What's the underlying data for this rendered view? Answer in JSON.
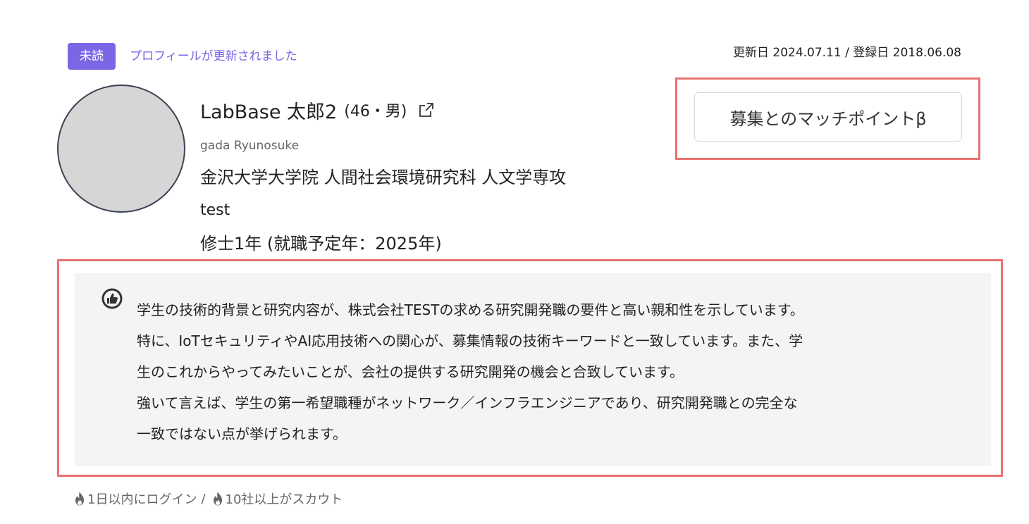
{
  "header": {
    "unread_badge": "未読",
    "update_link": "プロフィールが更新されました",
    "dates": "更新日 2024.07.11 / 登録日 2018.06.08"
  },
  "profile": {
    "name": "LabBase 太郎2",
    "age_gender": "(46・男)",
    "romaji": "gada Ryunosuke",
    "school": "金沢大学大学院 人間社会環境研究科 人文学専攻",
    "lab": "test",
    "grade": "修士1年 (就職予定年：2025年)"
  },
  "match_button": {
    "label": "募集とのマッチポイントβ"
  },
  "analysis": {
    "icon": "thumbs-up-icon",
    "lines": [
      "学生の技術的背景と研究内容が、株式会社TESTの求める研究開発職の要件と高い親和性を示しています。",
      "特に、IoTセキュリティやAI応用技術への関心が、募集情報の技術キーワードと一致しています。また、学",
      "生のこれからやってみたいことが、会社の提供する研究開発の機会と合致しています。",
      "強いて言えば、学生の第一希望職種がネットワーク／インフラエンジニアであり、研究開発職との完全な",
      "一致ではない点が挙げられます。"
    ]
  },
  "footer": {
    "login_status": "1日以内にログイン",
    "separator": "/",
    "scout_status": "10社以上がスカウト",
    "icon": "flame-icon"
  },
  "colors": {
    "accent": "#7a67e6",
    "highlight_border": "#e87272",
    "analysis_bg": "#f3f5f4"
  }
}
